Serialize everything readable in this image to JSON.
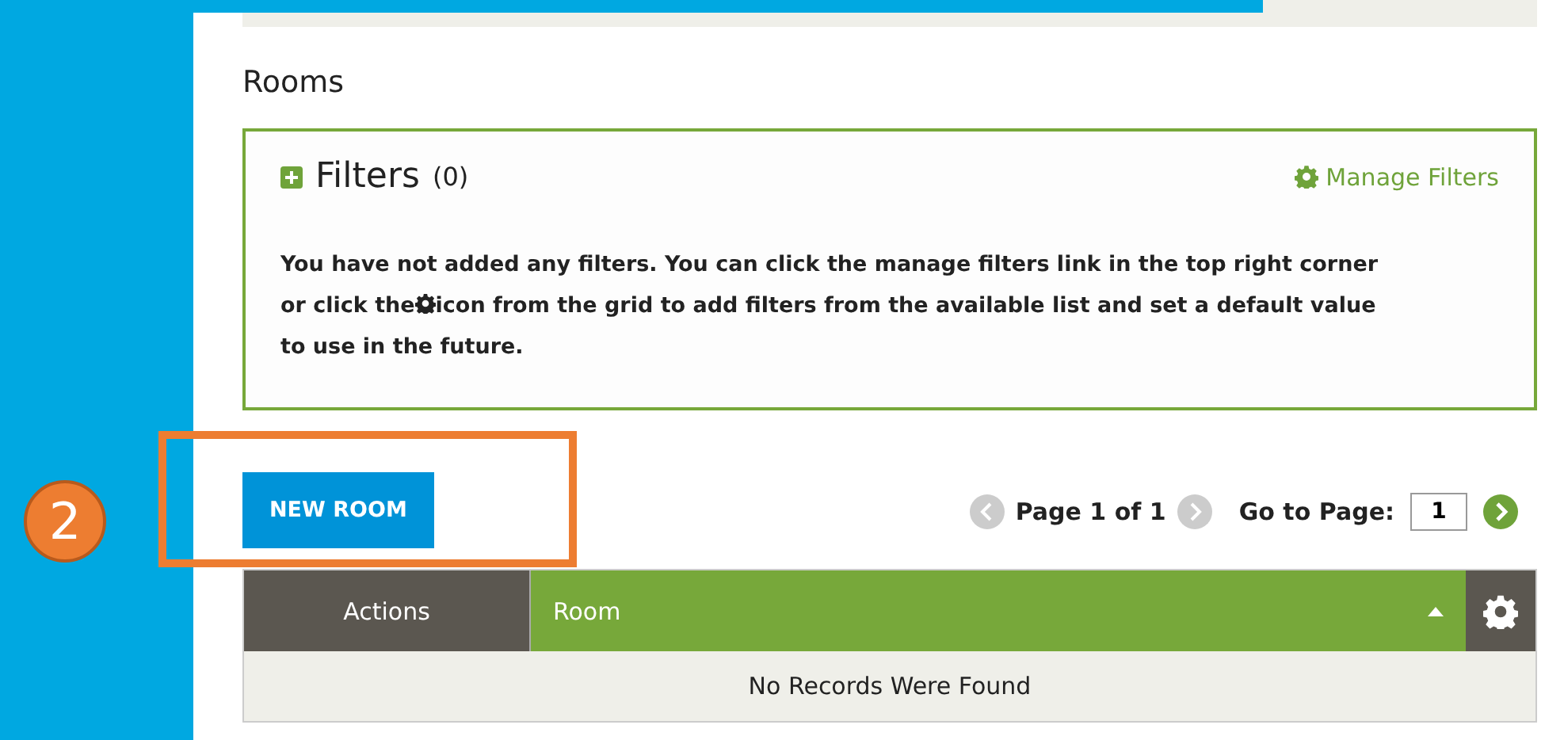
{
  "section_title": "Rooms",
  "filters": {
    "title": "Filters",
    "count": "(0)",
    "manage_link": "Manage Filters",
    "expanded": false,
    "message_line_1": "You have not added any filters. You can click the manage filters link in the top right corner",
    "message_line_2_before": "or click the",
    "message_line_2_after": "icon from the grid to add filters from the available list and set a default value",
    "message_line_3": "to use in the future."
  },
  "new_button": "NEW ROOM",
  "step_badge": "2",
  "pager": {
    "info": "Page 1 of 1",
    "goto_label": "Go to Page:",
    "page_value": "1",
    "prev_disabled": true,
    "next_disabled": true
  },
  "table": {
    "columns": [
      {
        "label": "Actions",
        "kind": "plain"
      },
      {
        "label": "Room",
        "kind": "sorted"
      }
    ],
    "sort_ascending": true,
    "empty_message": "No Records Were Found"
  }
}
